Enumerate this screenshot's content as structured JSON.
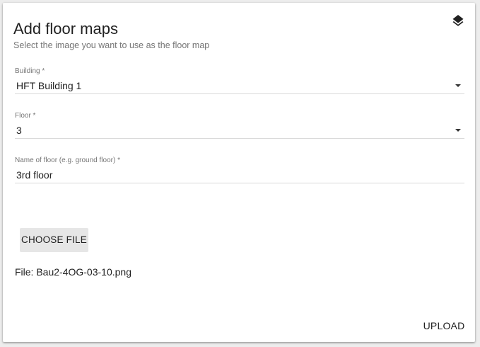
{
  "header": {
    "title": "Add floor maps",
    "subtitle": "Select the image you want to use as the floor map",
    "icon": "layers-icon"
  },
  "form": {
    "building": {
      "label": "Building *",
      "value": "HFT Building 1"
    },
    "floor": {
      "label": "Floor *",
      "value": "3"
    },
    "floor_name": {
      "label": "Name of floor (e.g. ground floor) *",
      "value": "3rd floor"
    }
  },
  "file": {
    "choose_label": "CHOOSE FILE",
    "file_text": "File: Bau2-4OG-03-10.png"
  },
  "actions": {
    "upload_label": "UPLOAD"
  },
  "colors": {
    "card_background": "#ffffff",
    "page_background": "#ededed",
    "button_background": "#e6e6e6",
    "text_primary": "#212121",
    "text_secondary": "#757575"
  }
}
